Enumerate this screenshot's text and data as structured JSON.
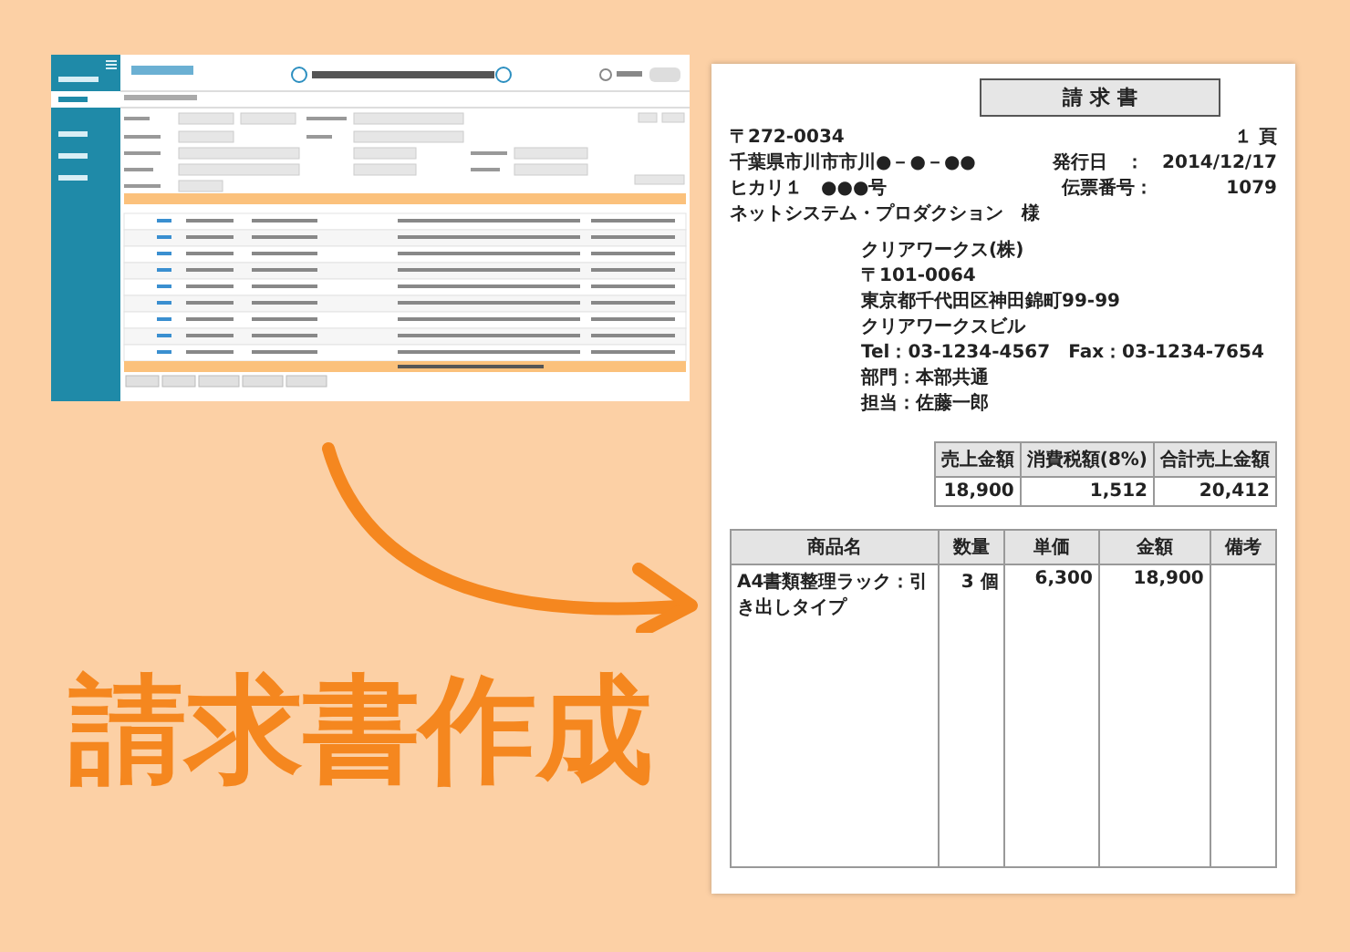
{
  "headline": "請求書作成",
  "invoice": {
    "title": "請 求 書",
    "page": "１ 頁",
    "customer": [
      "〒272-0034",
      "千葉県市川市市川●－●－●●",
      "ヒカリ１　●●●号"
    ],
    "customer_name": "ネットシステム・プロダクション　様",
    "meta": [
      {
        "label": "発行日　：",
        "value": "2014/12/17"
      },
      {
        "label": "伝票番号：",
        "value": "1079"
      }
    ],
    "issuer": [
      "クリアワークス(株)",
      "〒101-0064",
      "東京都千代田区神田錦町99-99",
      "クリアワークスビル",
      "Tel：03-1234-4567　Fax：03-1234-7654",
      "部門：本部共通",
      "担当：佐藤一郎"
    ],
    "summary": {
      "columns": [
        "売上金額",
        "消費税額(8%)",
        "合計売上金額"
      ],
      "values": [
        "18,900",
        "1,512",
        "20,412"
      ]
    },
    "items": {
      "columns": [
        "商品名",
        "数量",
        "単価",
        "金額",
        "備考"
      ],
      "rows": [
        [
          "A4書類整理ラック：引き出しタイプ",
          "3 個",
          "6,300",
          "18,900"
        ]
      ]
    }
  }
}
